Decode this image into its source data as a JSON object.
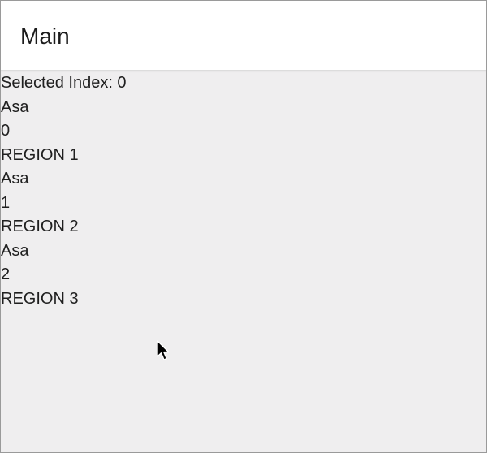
{
  "app_bar": {
    "title": "Main"
  },
  "status": {
    "selected_index_label": "Selected Index: 0"
  },
  "regions": [
    {
      "name": "Asa",
      "index": "0",
      "region_label": "REGION 1"
    },
    {
      "name": "Asa",
      "index": "1",
      "region_label": "REGION 2"
    },
    {
      "name": "Asa",
      "index": "2",
      "region_label": "REGION 3"
    }
  ],
  "icons": {
    "cursor": "mouse-pointer-icon"
  },
  "colors": {
    "background": "#efeeef",
    "app_bar": "#ffffff",
    "text": "#1f1f1f"
  }
}
